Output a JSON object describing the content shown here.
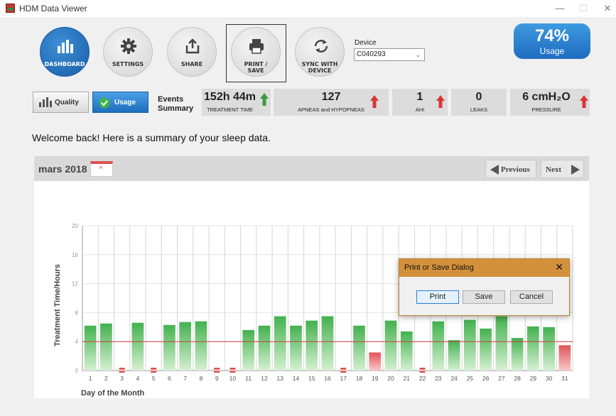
{
  "window": {
    "title": "HDM Data Viewer",
    "minimize": "—",
    "maximize": "☐",
    "close": "✕"
  },
  "toolbar": {
    "dashboard": "DASHBOARD",
    "settings": "SETTINGS",
    "share": "SHARE",
    "print_line1": "PRINT /",
    "print_line2": "SAVE",
    "sync_line1": "SYNC WITH",
    "sync_line2": "DEVICE"
  },
  "device": {
    "label": "Device",
    "value": "C040293"
  },
  "usage_badge": {
    "percent": "74%",
    "label": "Usage"
  },
  "toggles": {
    "quality": "Quality",
    "usage": "Usage"
  },
  "events": {
    "line1": "Events",
    "line2": "Summary"
  },
  "stats": [
    {
      "value": "152h 44m",
      "caption": "TREATMENT TIME",
      "trend": "up-green"
    },
    {
      "value": "127",
      "caption": "APNEAS and HYPOPNEAS",
      "trend": "up-red"
    },
    {
      "value": "1",
      "caption": "AHI",
      "trend": "up-red"
    },
    {
      "value": "0",
      "caption": "LEAKS",
      "trend": "none"
    },
    {
      "value": "6 cmH₂O",
      "caption": "PRESSURE",
      "trend": "up-red"
    }
  ],
  "welcome": "Welcome back! Here is a summary of your sleep data.",
  "calendar": {
    "month": "mars 2018",
    "previous": "Previous",
    "next": "Next"
  },
  "chart_data": {
    "type": "bar",
    "ylabel": "Treatment Time/Hours",
    "xlabel": "Day of the Month",
    "ylim": [
      0,
      20
    ],
    "yticks": [
      0,
      4,
      8,
      12,
      16,
      20
    ],
    "threshold": 4,
    "grid": true,
    "categories": [
      "1",
      "2",
      "3",
      "4",
      "5",
      "6",
      "7",
      "8",
      "9",
      "10",
      "11",
      "12",
      "13",
      "14",
      "15",
      "16",
      "17",
      "18",
      "19",
      "20",
      "21",
      "22",
      "23",
      "24",
      "25",
      "26",
      "27",
      "28",
      "29",
      "30",
      "31"
    ],
    "values": [
      6.2,
      6.5,
      0,
      6.6,
      0,
      6.3,
      6.7,
      6.8,
      0,
      0,
      5.6,
      6.2,
      7.5,
      6.2,
      6.9,
      7.5,
      0,
      6.2,
      2.5,
      6.9,
      5.4,
      0,
      6.8,
      4.2,
      7.0,
      5.8,
      7.5,
      4.5,
      6.1,
      6.0,
      3.5
    ],
    "colors": {
      "good": "#43b14f",
      "bad": "#e05358",
      "threshold_line": "#d43a3a"
    }
  },
  "dialog": {
    "title": "Print or Save Dialog",
    "print": "Print",
    "save": "Save",
    "cancel": "Cancel"
  }
}
